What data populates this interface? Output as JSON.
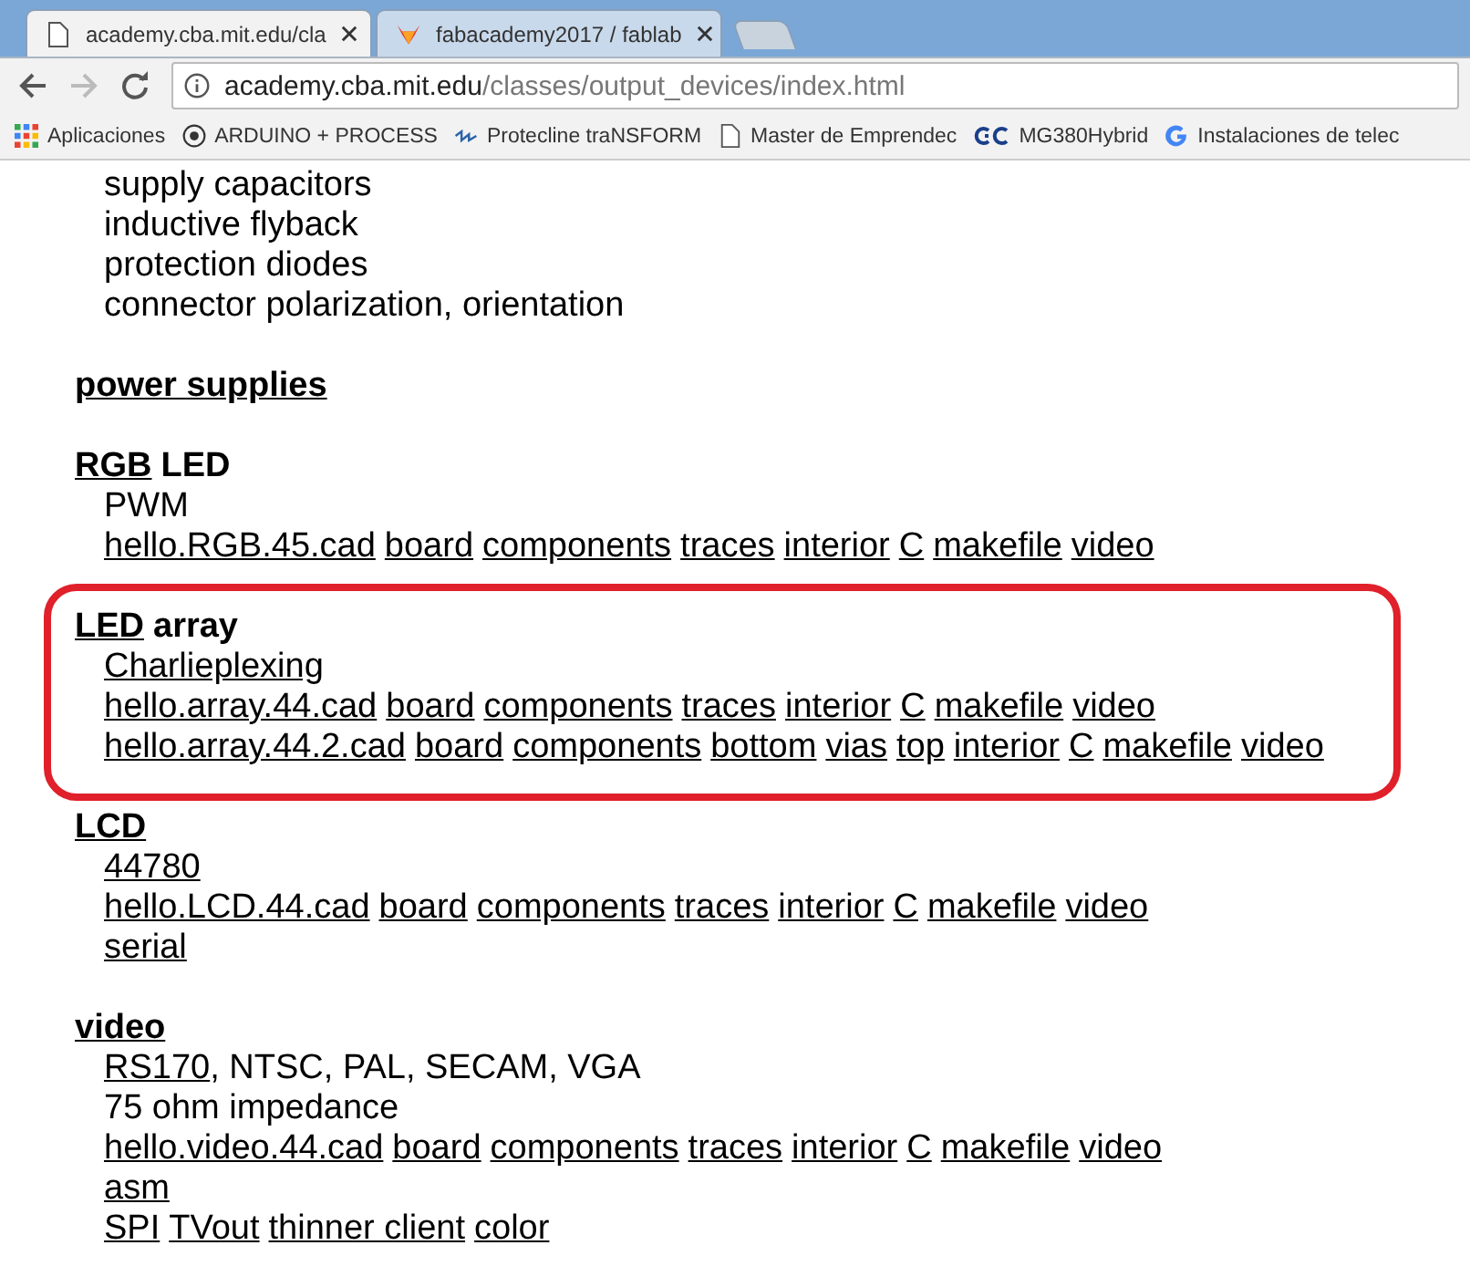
{
  "tabs": [
    {
      "title": "academy.cba.mit.edu/cla",
      "selected": true
    },
    {
      "title": "fabacademy2017 / fablab",
      "selected": false
    },
    {
      "selected": false
    }
  ],
  "address": {
    "host": "academy.cba.mit.edu",
    "path": "/classes/output_devices/index.html"
  },
  "bookmarks": [
    {
      "label": "Aplicaciones"
    },
    {
      "label": "ARDUINO + PROCESS"
    },
    {
      "label": "Protecline traNSFORM"
    },
    {
      "label": "Master de Emprendec"
    },
    {
      "label": "MG380Hybrid"
    },
    {
      "label": "Instalaciones de telec"
    }
  ],
  "sections": [
    {
      "highlighted": false,
      "lines": [
        [
          {
            "text": "supply capacitors",
            "link": false
          }
        ],
        [
          {
            "text": "inductive flyback",
            "link": false
          }
        ],
        [
          {
            "text": "protection diodes",
            "link": false
          }
        ],
        [
          {
            "text": "connector polarization, orientation",
            "link": false
          }
        ]
      ]
    },
    {
      "heading": [
        {
          "text": "power supplies",
          "link": true
        }
      ],
      "highlighted": false
    },
    {
      "heading": [
        {
          "text": "RGB",
          "link": true
        },
        {
          "text": "LED",
          "link": false
        }
      ],
      "highlighted": false,
      "lines": [
        [
          {
            "text": "PWM",
            "link": false
          }
        ],
        [
          {
            "text": "hello.RGB.45.cad",
            "link": true
          },
          {
            "text": "board",
            "link": true
          },
          {
            "text": "components",
            "link": true
          },
          {
            "text": "traces",
            "link": true
          },
          {
            "text": "interior",
            "link": true
          },
          {
            "text": "C",
            "link": true
          },
          {
            "text": "makefile",
            "link": true
          },
          {
            "text": "video",
            "link": true
          }
        ]
      ]
    },
    {
      "heading": [
        {
          "text": "LED",
          "link": true
        },
        {
          "text": "array",
          "link": false
        }
      ],
      "highlighted": true,
      "lines": [
        [
          {
            "text": "Charlieplexing",
            "link": true
          }
        ],
        [
          {
            "text": "hello.array.44.cad",
            "link": true
          },
          {
            "text": "board",
            "link": true
          },
          {
            "text": "components",
            "link": true
          },
          {
            "text": "traces",
            "link": true
          },
          {
            "text": "interior",
            "link": true
          },
          {
            "text": "C",
            "link": true
          },
          {
            "text": "makefile",
            "link": true
          },
          {
            "text": "video",
            "link": true
          }
        ],
        [
          {
            "text": "hello.array.44.2.cad",
            "link": true
          },
          {
            "text": "board",
            "link": true
          },
          {
            "text": "components",
            "link": true
          },
          {
            "text": "bottom",
            "link": true
          },
          {
            "text": "vias",
            "link": true
          },
          {
            "text": "top",
            "link": true
          },
          {
            "text": "interior",
            "link": true
          },
          {
            "text": "C",
            "link": true
          },
          {
            "text": "makefile",
            "link": true
          },
          {
            "text": "video",
            "link": true
          }
        ]
      ]
    },
    {
      "heading": [
        {
          "text": "LCD",
          "link": true
        }
      ],
      "highlighted": false,
      "lines": [
        [
          {
            "text": "44780",
            "link": true
          }
        ],
        [
          {
            "text": "hello.LCD.44.cad",
            "link": true
          },
          {
            "text": "board",
            "link": true
          },
          {
            "text": "components",
            "link": true
          },
          {
            "text": "traces",
            "link": true
          },
          {
            "text": "interior",
            "link": true
          },
          {
            "text": "C",
            "link": true
          },
          {
            "text": "makefile",
            "link": true
          },
          {
            "text": "video",
            "link": true
          }
        ],
        [
          {
            "text": "serial",
            "link": true
          }
        ]
      ]
    },
    {
      "heading": [
        {
          "text": "video",
          "link": true
        }
      ],
      "highlighted": false,
      "lines": [
        [
          {
            "text": "RS170",
            "link": true
          },
          {
            "text": ", NTSC, PAL, SECAM, VGA",
            "link": false,
            "attached": true
          }
        ],
        [
          {
            "text": "75 ohm impedance",
            "link": false
          }
        ],
        [
          {
            "text": "hello.video.44.cad",
            "link": true
          },
          {
            "text": "board",
            "link": true
          },
          {
            "text": "components",
            "link": true
          },
          {
            "text": "traces",
            "link": true
          },
          {
            "text": "interior",
            "link": true
          },
          {
            "text": "C",
            "link": true
          },
          {
            "text": "makefile",
            "link": true
          },
          {
            "text": "video",
            "link": true
          }
        ],
        [
          {
            "text": "asm",
            "link": true
          }
        ],
        [
          {
            "text": "SPI",
            "link": true
          },
          {
            "text": "TVout",
            "link": true
          },
          {
            "text": "thinner client",
            "link": true
          },
          {
            "text": "color",
            "link": true
          }
        ]
      ]
    }
  ]
}
